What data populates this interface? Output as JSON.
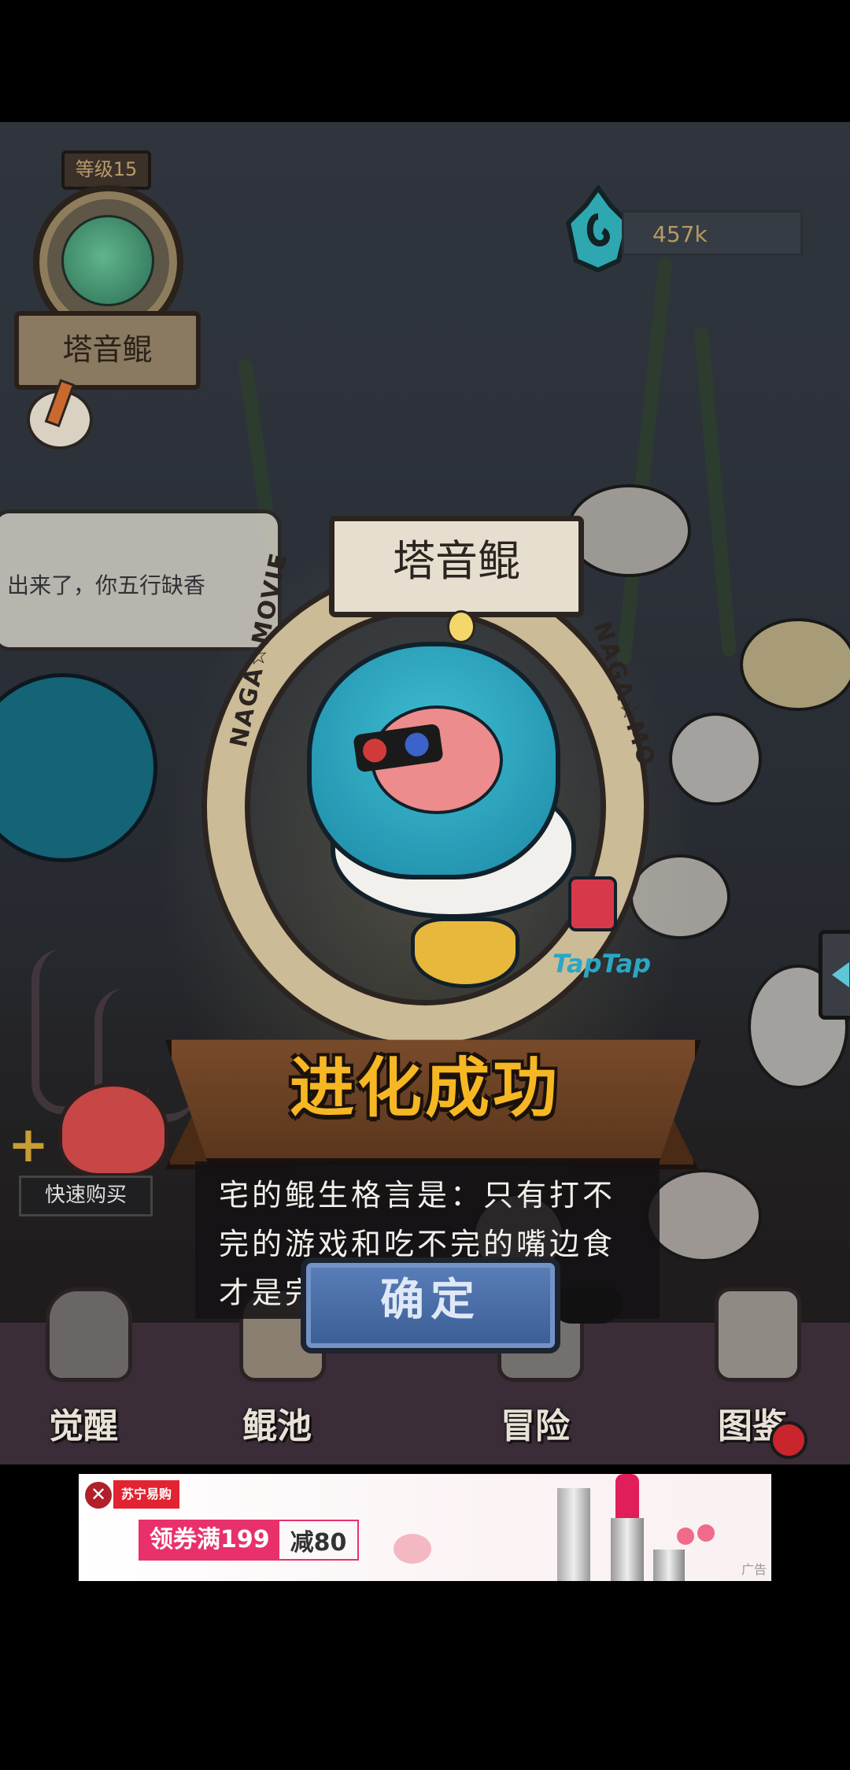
{
  "hud": {
    "level_label": "等级15",
    "fish_name": "塔音鲲",
    "currency_value": "457k"
  },
  "speech_bubble": {
    "text": "出来了，你五行缺香"
  },
  "quick_buy": {
    "plus": "+",
    "label": "快速购买"
  },
  "evolution_dialog": {
    "fish_name": "塔音鲲",
    "ring_text_left": "NAGA☆MOVIE",
    "ring_text_right": "NAGA☆MO",
    "brand_text": "TapTap",
    "title": "进化成功",
    "description": "宅的鲲生格言是：只有打不完的游戏和吃不完的嘴边食才是完整的鲲生",
    "confirm_label": "确定"
  },
  "bottom_nav": {
    "items": [
      {
        "label": "觉醒",
        "icon": "awaken-icon"
      },
      {
        "label": "鲲池",
        "icon": "fishpond-icon"
      },
      {
        "label": "冒险",
        "icon": "adventure-icon"
      },
      {
        "label": "图鉴",
        "icon": "collection-icon"
      }
    ]
  },
  "ad_banner": {
    "close": "✕",
    "logo": "苏宁易购 818",
    "promo_left": "领券满199",
    "promo_right": "减80",
    "tag": "广告"
  },
  "colors": {
    "title_gold": "#f6b724",
    "confirm_blue": "#3a5d95",
    "teal_fish": "#1c8aa6",
    "promo_pink": "#e8316a"
  }
}
